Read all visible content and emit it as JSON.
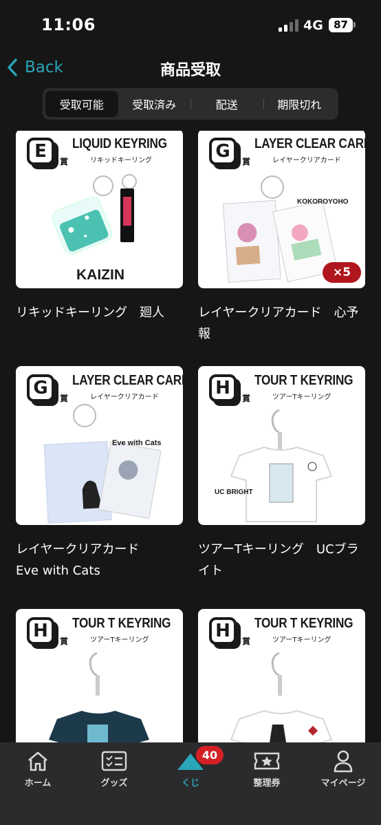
{
  "status_bar": {
    "time": "11:06",
    "network": "4G",
    "battery": "87"
  },
  "nav": {
    "back_label": "Back",
    "title": "商品受取"
  },
  "tabs": [
    {
      "label": "受取可能",
      "active": true
    },
    {
      "label": "受取済み",
      "active": false
    },
    {
      "label": "配送",
      "active": false
    },
    {
      "label": "期限切れ",
      "active": false
    }
  ],
  "items": [
    {
      "prize": "E",
      "prize_suffix": "賞",
      "title": "LIQUID KEYRING",
      "subtitle": "リキッドキーリング",
      "caption": "KAIZIN",
      "name": "リキッドキーリング　廻人"
    },
    {
      "prize": "G",
      "prize_suffix": "賞",
      "title": "LAYER CLEAR CARD",
      "subtitle": "レイヤークリアカード",
      "caption": "KOKOROYOHO",
      "quantity": "×5",
      "name": "レイヤークリアカード　心予報"
    },
    {
      "prize": "G",
      "prize_suffix": "賞",
      "title": "LAYER CLEAR CARD",
      "subtitle": "レイヤークリアカード",
      "caption": "Eve with Cats",
      "name": "レイヤークリアカード\nEve with Cats"
    },
    {
      "prize": "H",
      "prize_suffix": "賞",
      "title": "TOUR T KEYRING",
      "subtitle": "ツアーTキーリング",
      "caption": "UC BRIGHT",
      "name": "ツアーTキーリング　UCブライト"
    },
    {
      "prize": "H",
      "prize_suffix": "賞",
      "title": "TOUR T KEYRING",
      "subtitle": "ツアーTキーリング",
      "caption": "",
      "name": ""
    },
    {
      "prize": "H",
      "prize_suffix": "賞",
      "title": "TOUR T KEYRING",
      "subtitle": "ツアーTキーリング",
      "caption": "",
      "name": ""
    }
  ],
  "tabbar": {
    "items": [
      {
        "label": "ホーム",
        "icon": "home-icon"
      },
      {
        "label": "グッズ",
        "icon": "list-icon"
      },
      {
        "label": "くじ",
        "icon": "kuji-triangle-icon",
        "badge": "40",
        "active": true
      },
      {
        "label": "整理券",
        "icon": "ticket-icon"
      },
      {
        "label": "マイページ",
        "icon": "person-icon"
      }
    ]
  },
  "colors": {
    "accent": "#2aa5b9",
    "badge": "#d32026",
    "quantity_badge": "#b0161e",
    "background": "#161616"
  }
}
